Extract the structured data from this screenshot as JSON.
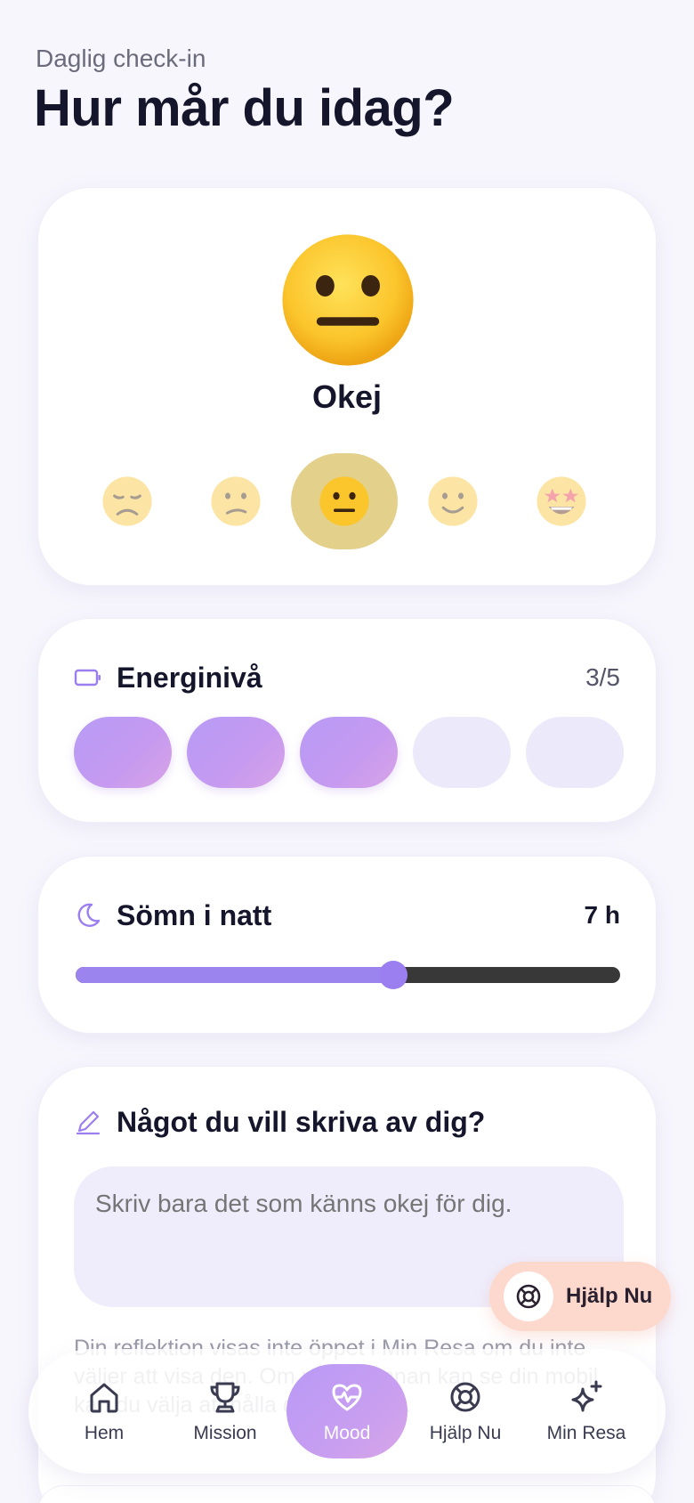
{
  "header": {
    "subtitle": "Daglig check-in",
    "title": "Hur mår du idag?"
  },
  "mood": {
    "selected_label": "Okej",
    "selected_index": 2,
    "options": [
      "very-sad-face-icon",
      "sad-face-icon",
      "neutral-face-icon",
      "smiling-face-icon",
      "star-struck-face-icon"
    ]
  },
  "energy": {
    "label": "Energinivå",
    "value_text": "3/5",
    "level": 3,
    "max": 5
  },
  "sleep": {
    "label": "Sömn i natt",
    "value_text": "7 h",
    "hours": 7,
    "min": 0,
    "max": 12
  },
  "journal": {
    "label": "Något du vill skriva av dig?",
    "placeholder": "Skriv bara det som känns okej för dig.",
    "note": "Din reflektion visas inte öppet i Min Resa om du inte väljer att visa den. Om någon annan kan se din mobil kan du välja att hålla den dold här."
  },
  "help_button": {
    "label": "Hjälp Nu"
  },
  "nav": {
    "items": [
      {
        "label": "Hem",
        "icon": "home-icon"
      },
      {
        "label": "Mission",
        "icon": "trophy-icon"
      },
      {
        "label": "Mood",
        "icon": "heart-pulse-icon"
      },
      {
        "label": "Hjälp Nu",
        "icon": "lifebuoy-icon"
      },
      {
        "label": "Min Resa",
        "icon": "sparkles-icon"
      }
    ],
    "active_index": 2
  },
  "colors": {
    "accent": "#9b7ef0",
    "mood_selected_bg": "#e3d08a",
    "help_bg": "#fdd8cd"
  }
}
